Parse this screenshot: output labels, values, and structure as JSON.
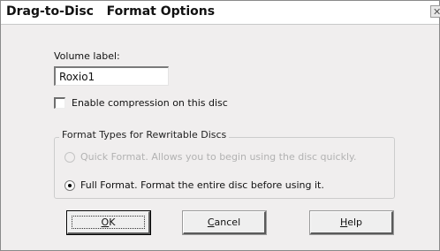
{
  "window": {
    "title": "Drag-to-Disc   Format Options",
    "close_glyph": "✕"
  },
  "volume": {
    "label": "Volume label:",
    "value": "Roxio1"
  },
  "compression": {
    "label": "Enable compression on this disc",
    "checked": false
  },
  "format_group": {
    "legend": "Format Types for Rewritable Discs",
    "options": [
      {
        "label": "Quick Format. Allows you to begin using the disc quickly.",
        "selected": false,
        "enabled": false
      },
      {
        "label": "Full Format. Format the entire disc before using it.",
        "selected": true,
        "enabled": true
      }
    ]
  },
  "buttons": {
    "ok": {
      "mnemonic": "O",
      "rest": "K"
    },
    "cancel": {
      "mnemonic": "C",
      "rest": "ancel"
    },
    "help": {
      "mnemonic": "H",
      "rest": "elp"
    }
  }
}
